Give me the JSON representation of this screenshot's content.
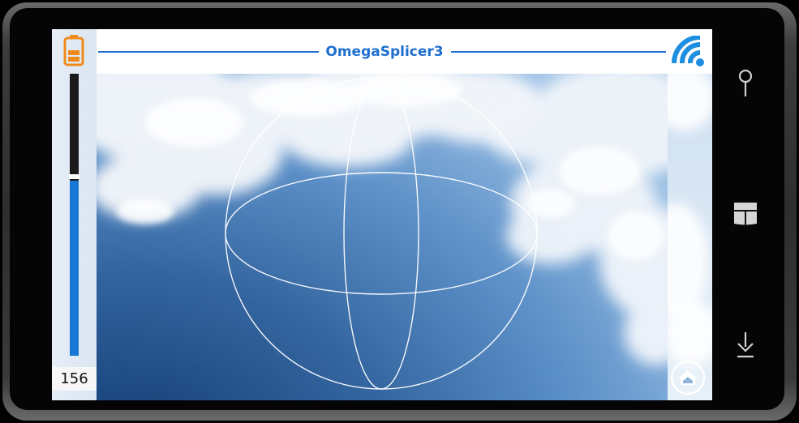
{
  "app": {
    "title": "OmegaSplicer3",
    "level_value": "156",
    "level_fraction": 0.62
  },
  "colors": {
    "accent": "#1e6fd0",
    "battery": "#f08a1b",
    "level_fill": "#1877d6"
  },
  "icons": {
    "battery": "battery-icon",
    "wifi": "wifi-signal-icon",
    "home": "home-icon",
    "search": "search-icon",
    "start": "windows-start-icon",
    "back": "back-arrow-icon"
  }
}
